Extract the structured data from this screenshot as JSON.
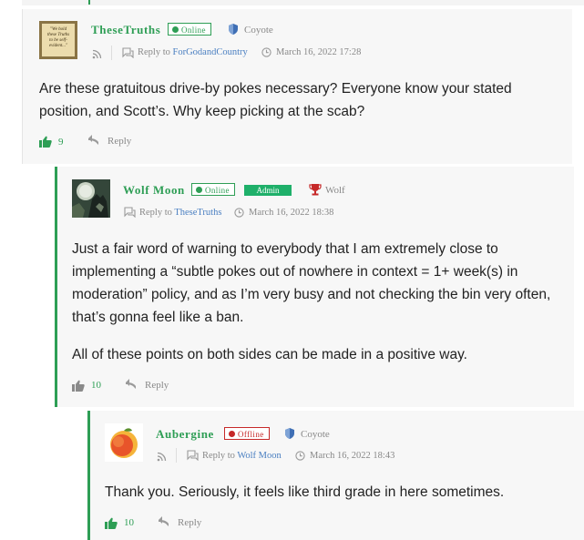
{
  "comments": [
    {
      "author": "TheseTruths",
      "status": "Online",
      "role": "Coyote",
      "reply_prefix": "Reply to",
      "reply_to": "ForGodandCountry",
      "date": "March 16, 2022 17:28",
      "body": [
        "Are these gratuitous drive-by pokes necessary? Everyone know your stated position, and Scott’s. Why keep picking at the scab?"
      ],
      "votes": "9",
      "reply_label": "Reply",
      "avatar_text": [
        "\"We hold",
        "these Truths",
        "to be self-",
        "evident...\""
      ]
    },
    {
      "author": "Wolf Moon",
      "status": "Online",
      "admin_label": "Admin",
      "role": "Wolf",
      "reply_prefix": "Reply to",
      "reply_to": "TheseTruths",
      "date": "March 16, 2022 18:38",
      "body": [
        "Just a fair word of warning to everybody that I am extremely close to implementing a “subtle pokes out of nowhere in context = 1+ week(s) in moderation” policy, and as I’m very busy and not checking the bin very often, that’s gonna feel like a ban.",
        "All of these points on both sides can be made in a positive way."
      ],
      "votes": "10",
      "reply_label": "Reply"
    },
    {
      "author": "Aubergine",
      "status": "Offline",
      "role": "Coyote",
      "reply_prefix": "Reply to",
      "reply_to": "Wolf Moon",
      "date": "March 16, 2022 18:43",
      "body": [
        "Thank you. Seriously, it feels like third grade in here sometimes."
      ],
      "votes": "10",
      "reply_label": "Reply"
    }
  ],
  "colors": {
    "accent": "#2e9e55",
    "offline": "#c62828",
    "link": "#4a7fc1",
    "meta": "#888888",
    "card_bg": "#f7f7f7"
  },
  "icons": {
    "rss": "rss-icon",
    "reply_to": "reply-chat-icon",
    "date": "clock-icon",
    "role_coyote": "shield-icon",
    "role_wolf": "trophy-icon",
    "vote": "thumbs-up-icon",
    "reply": "reply-arrow-icon"
  }
}
